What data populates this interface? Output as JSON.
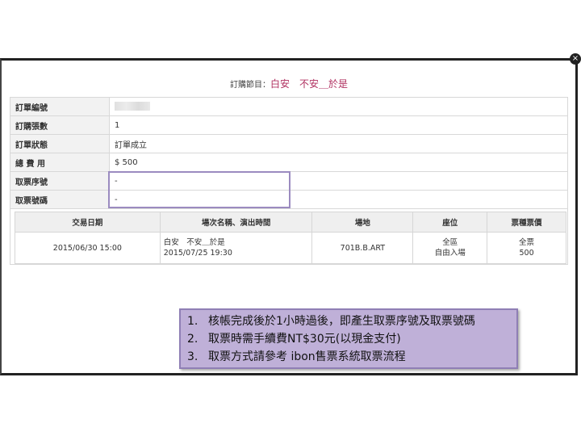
{
  "dialog": {
    "title_label": "訂購節目：",
    "show_name": "白安　不安＿於是",
    "close_glyph": "×"
  },
  "order_info": [
    {
      "label": "訂單編號",
      "value": ""
    },
    {
      "label": "訂購張數",
      "value": "1"
    },
    {
      "label": "訂單狀態",
      "value": "訂單成立"
    },
    {
      "label": "總 費 用",
      "value": "$ 500"
    },
    {
      "label": "取票序號",
      "value": "-"
    },
    {
      "label": "取票號碼",
      "value": "-"
    }
  ],
  "details": {
    "headers": [
      "交易日期",
      "場次名稱、演出時間",
      "場地",
      "座位",
      "票種票價"
    ],
    "row": {
      "date": "2015/06/30 15:00",
      "event_name": "白安　不安＿於是",
      "event_time": "2015/07/25 19:30",
      "venue": "701B.B.ART",
      "seat_area": "全區",
      "seat_type": "自由入場",
      "ticket_type": "全票",
      "price": "500"
    }
  },
  "notes": [
    {
      "num": "1.",
      "text": "核帳完成後於1小時過後，即產生取票序號及取票號碼"
    },
    {
      "num": "2.",
      "text": "取票時需手續費NT$30元(以現金支付)"
    },
    {
      "num": "3.",
      "text": "取票方式請參考 ibon售票系統取票流程"
    }
  ],
  "colors": {
    "accent": "#b03060",
    "highlight_border": "#9b8bc0",
    "note_bg": "#bfb0d8"
  }
}
